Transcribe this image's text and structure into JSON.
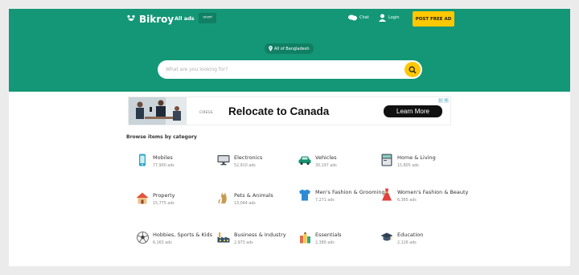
{
  "header": {
    "logo_text": "Bikroy",
    "all_ads": "All ads",
    "language": "বাংলা",
    "chat": "Chat",
    "login": "Login",
    "post_ad": "POST FREE AD"
  },
  "location": {
    "label": "All of Bangladesh"
  },
  "search": {
    "placeholder": "What are you looking for?"
  },
  "ad_banner": {
    "brand": "CIREGS",
    "headline": "Relocate to Canada",
    "cta": "Learn More"
  },
  "categories_title": "Browse items by category",
  "categories": [
    {
      "name": "Mobiles",
      "count": "77,900 ads",
      "icon": "mobile-phone-icon"
    },
    {
      "name": "Electronics",
      "count": "52,910 ads",
      "icon": "monitor-icon"
    },
    {
      "name": "Vehicles",
      "count": "30,197 ads",
      "icon": "car-icon"
    },
    {
      "name": "Home & Living",
      "count": "15,805 ads",
      "icon": "appliance-icon"
    },
    {
      "name": "Property",
      "count": "15,775 ads",
      "icon": "house-icon"
    },
    {
      "name": "Pets & Animals",
      "count": "13,044 ads",
      "icon": "cat-icon"
    },
    {
      "name": "Men's Fashion & Grooming",
      "count": "7,271 ads",
      "icon": "shirt-icon"
    },
    {
      "name": "Women's Fashion & Beauty",
      "count": "6,365 ads",
      "icon": "dress-icon"
    },
    {
      "name": "Hobbies, Sports & Kids",
      "count": "6,163 ads",
      "icon": "football-icon"
    },
    {
      "name": "Business & Industry",
      "count": "2,973 ads",
      "icon": "factory-icon"
    },
    {
      "name": "Essentials",
      "count": "2,380 ads",
      "icon": "grocery-icon"
    },
    {
      "name": "Education",
      "count": "2,126 ads",
      "icon": "graduation-cap-icon"
    }
  ],
  "colors": {
    "brand_green": "#149777",
    "accent_yellow": "#ffc800"
  }
}
